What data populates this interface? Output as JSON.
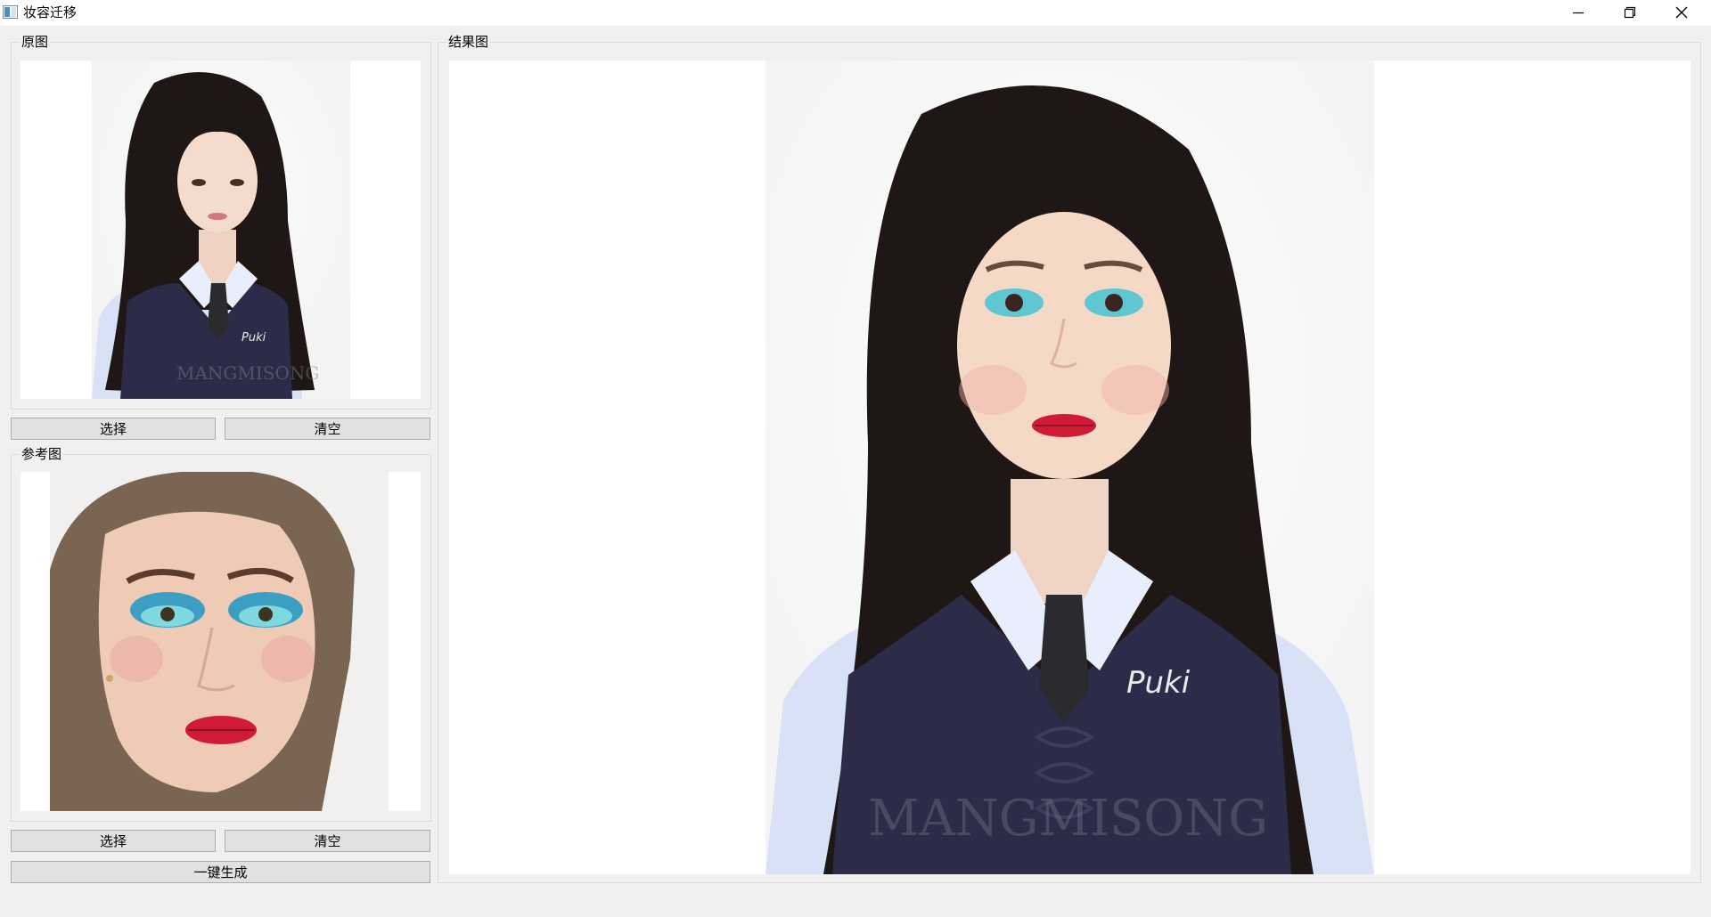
{
  "window": {
    "title": "妆容迁移",
    "icons": {
      "app": "app-window-icon",
      "minimize": "minimize-icon",
      "maximize": "restore-icon",
      "close": "close-icon"
    }
  },
  "source_panel": {
    "title": "原图",
    "image_text": "Puki",
    "watermark": "MANGMISONG",
    "select_label": "选择",
    "clear_label": "清空"
  },
  "reference_panel": {
    "title": "参考图",
    "select_label": "选择",
    "clear_label": "清空"
  },
  "generate_label": "一键生成",
  "result_panel": {
    "title": "结果图",
    "image_text": "Puki",
    "watermark": "MANGMISONG"
  },
  "colors": {
    "window_bg": "#f0f0f0",
    "button_bg": "#e1e1e1",
    "button_border": "#adadad",
    "eyeshadow": "#5fc6d2",
    "lipstick": "#d11a36",
    "vest": "#2c2c49",
    "shirt": "#d8e1f6"
  }
}
